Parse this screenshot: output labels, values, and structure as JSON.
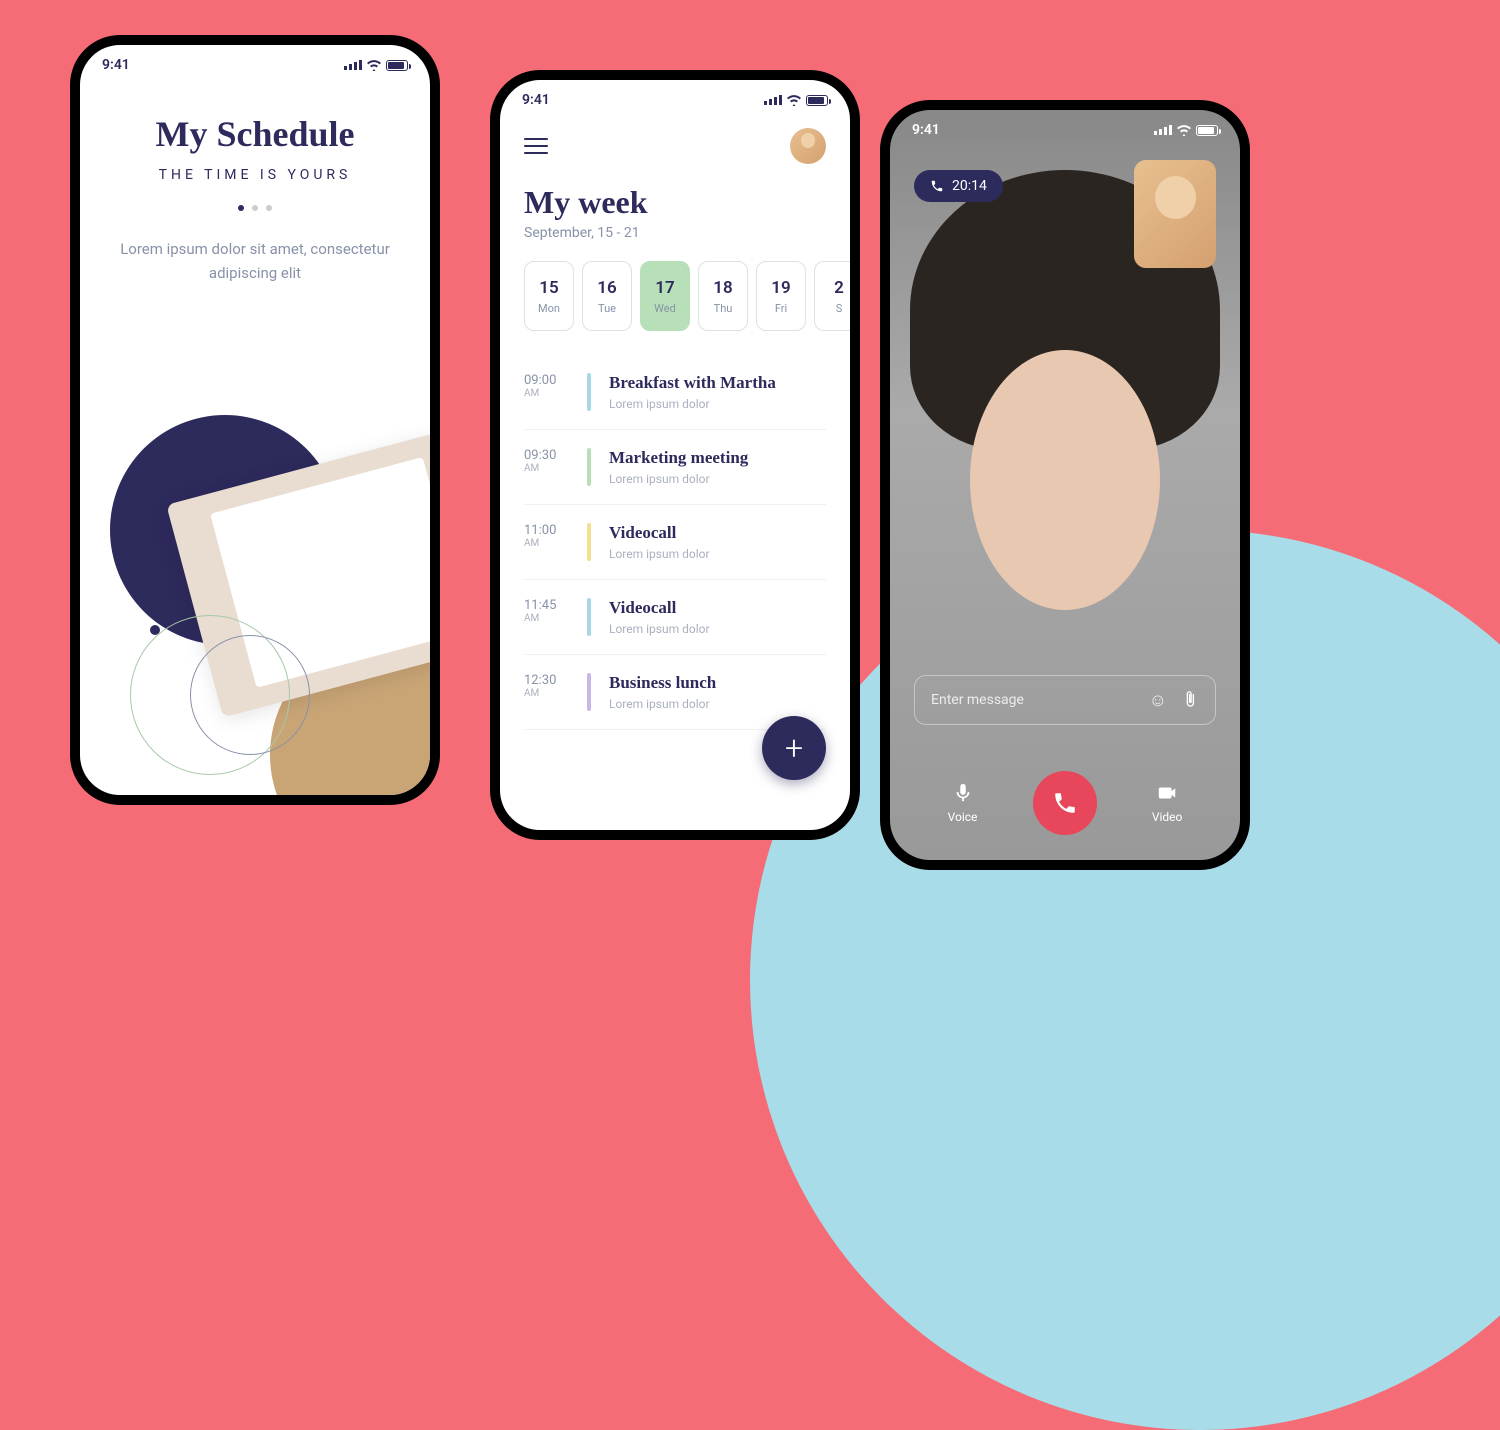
{
  "status": {
    "time": "9:41"
  },
  "phone1": {
    "title": "My Schedule",
    "subtitle": "THE TIME IS YOURS",
    "text": "Lorem ipsum dolor sit amet, consectetur adipiscing elit"
  },
  "phone2": {
    "title": "My week",
    "subtitle": "September, 15 - 21",
    "days": [
      {
        "num": "15",
        "name": "Mon"
      },
      {
        "num": "16",
        "name": "Tue"
      },
      {
        "num": "17",
        "name": "Wed"
      },
      {
        "num": "18",
        "name": "Thu"
      },
      {
        "num": "19",
        "name": "Fri"
      },
      {
        "num": "2",
        "name": "S"
      }
    ],
    "activeDay": 2,
    "events": [
      {
        "time": "09:00",
        "ampm": "AM",
        "title": "Breakfast with Martha",
        "desc": "Lorem ipsum dolor",
        "color": "#a8d8e8"
      },
      {
        "time": "09:30",
        "ampm": "AM",
        "title": "Marketing meeting",
        "desc": "Lorem ipsum dolor",
        "color": "#b8e0b8"
      },
      {
        "time": "11:00",
        "ampm": "AM",
        "title": "Videocall",
        "desc": "Lorem ipsum dolor",
        "color": "#f0e090"
      },
      {
        "time": "11:45",
        "ampm": "AM",
        "title": "Videocall",
        "desc": "Lorem ipsum dolor",
        "color": "#a8d8e8"
      },
      {
        "time": "12:30",
        "ampm": "AM",
        "title": "Business lunch",
        "desc": "Lorem ipsum dolor",
        "color": "#c8b8e8"
      }
    ]
  },
  "phone3": {
    "duration": "20:14",
    "placeholder": "Enter message",
    "voice": "Voice",
    "video": "Video"
  }
}
